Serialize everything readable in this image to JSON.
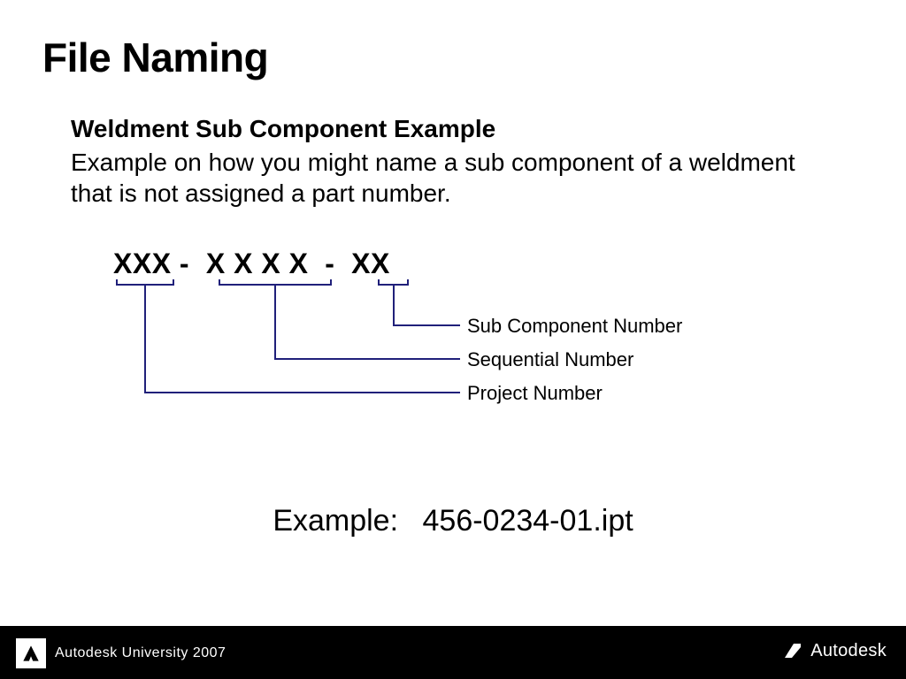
{
  "title": "File Naming",
  "subtitle": "Weldment Sub Component Example",
  "body": "Example on how you might name a sub component of a weldment that is not assigned a part number.",
  "diagram": {
    "pattern": "XXX -  X X X X  -  XX",
    "callouts": {
      "sub_component": "Sub Component Number",
      "sequential": "Sequential Number",
      "project": "Project Number"
    }
  },
  "example": {
    "label": "Example:",
    "value": "456-0234-01.ipt"
  },
  "footer": {
    "left": "Autodesk University 2007",
    "right": "Autodesk"
  }
}
